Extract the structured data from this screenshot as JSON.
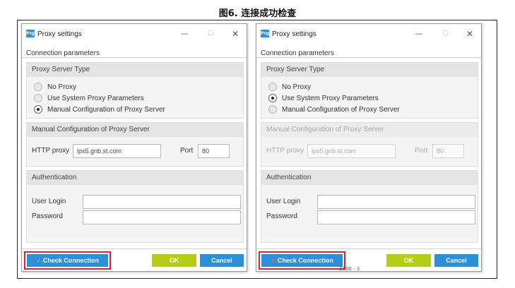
{
  "figure": {
    "title": "图6. 连接成功检查"
  },
  "dialogs": [
    {
      "app_icon": "Prg",
      "window_title": "Proxy settings",
      "window_controls": {
        "minimize": "—",
        "maximize": "☐",
        "close": "✕"
      },
      "connection_parameters": "Connection parameters",
      "proxy_server_type": {
        "heading": "Proxy Server Type",
        "options": [
          {
            "label": "No Proxy",
            "selected": false
          },
          {
            "label": "Use System Proxy Parameters",
            "selected": false
          },
          {
            "label": "Manual Configuration of Proxy Server",
            "selected": true
          }
        ]
      },
      "manual_config": {
        "heading": "Manual Configuration of Proxy Server",
        "enabled": true,
        "http_proxy_label": "HTTP proxy",
        "http_proxy_value": "lps5.gnb.st.com",
        "port_label": "Port",
        "port_value": "80"
      },
      "authentication": {
        "heading": "Authentication",
        "user_login_label": "User Login",
        "user_login_value": "",
        "password_label": "Password",
        "password_value": ""
      },
      "buttons": {
        "check_connection": "Check Connection",
        "check_status_icon": "check-icon",
        "check_status_glyph": "✓",
        "ok": "OK",
        "cancel": "Cancel"
      },
      "colors": {
        "primary": "#2f8fd6",
        "ok": "#b5cc18",
        "highlight": "#e0212b",
        "status": "#9bd65e"
      }
    },
    {
      "app_icon": "Prg",
      "window_title": "Proxy settings",
      "window_controls": {
        "minimize": "—",
        "maximize": "☐",
        "close": "✕"
      },
      "connection_parameters": "Connection parameters",
      "proxy_server_type": {
        "heading": "Proxy Server Type",
        "options": [
          {
            "label": "No Proxy",
            "selected": false
          },
          {
            "label": "Use System Proxy Parameters",
            "selected": true
          },
          {
            "label": "Manual Configuration of Proxy Server",
            "selected": false
          }
        ]
      },
      "manual_config": {
        "heading": "Manual Configuration of Proxy Server",
        "enabled": false,
        "http_proxy_label": "HTTP proxy",
        "http_proxy_value": "lps5.gnb.st.com",
        "port_label": "Port",
        "port_value": "80"
      },
      "authentication": {
        "heading": "Authentication",
        "user_login_label": "User Login",
        "user_login_value": "",
        "password_label": "Password",
        "password_value": ""
      },
      "buttons": {
        "check_connection": "Check Connection",
        "check_status_icon": "x-icon",
        "check_status_glyph": "✕",
        "ok": "OK",
        "cancel": "Cancel"
      },
      "stray_text": "1000 - 3",
      "colors": {
        "primary": "#2f8fd6",
        "ok": "#b5cc18",
        "highlight": "#e0212b",
        "status": "#ff5a5a"
      }
    }
  ]
}
